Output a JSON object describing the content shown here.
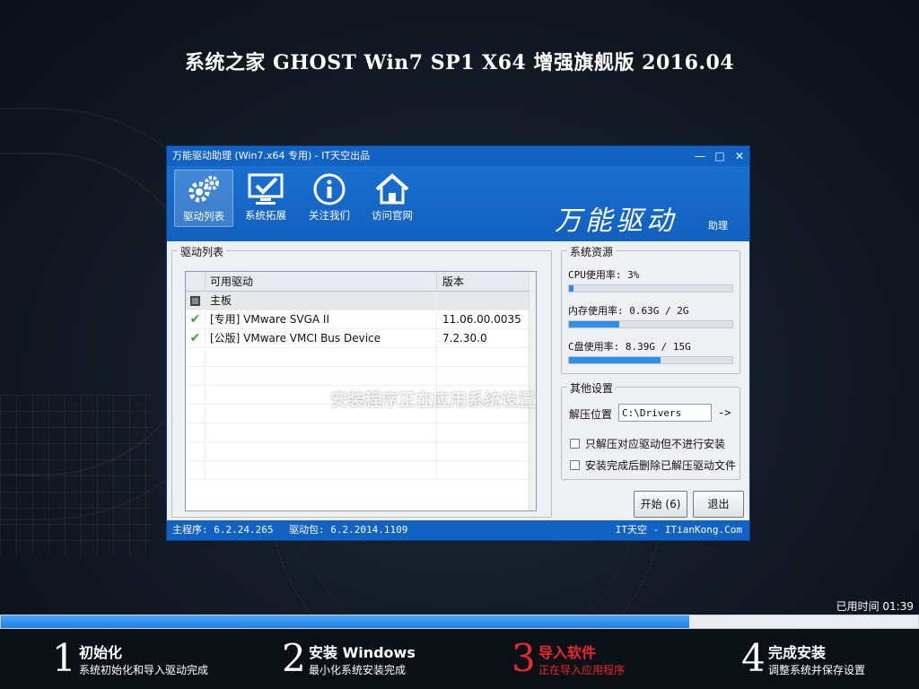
{
  "title": "系统之家 GHOST Win7 SP1 X64 增强旗舰版 2016.04",
  "window": {
    "title": "万能驱动助理 (Win7.x64 专用) - IT天空出品",
    "controls": [
      "—",
      "□",
      "✕"
    ],
    "brand": "万能驱动",
    "brand_sub": "助理",
    "toolbar": [
      {
        "label": "驱动列表",
        "icon": "gear-icon"
      },
      {
        "label": "系统拓展",
        "icon": "monitor-check-icon"
      },
      {
        "label": "关注我们",
        "icon": "info-icon"
      },
      {
        "label": "访问官网",
        "icon": "home-icon"
      }
    ],
    "driver_list": {
      "title": "驱动列表",
      "columns": [
        "可用驱动",
        "版本"
      ],
      "rows": [
        {
          "name": "主板",
          "version": "",
          "category": true
        },
        {
          "name": "[专用] VMware SVGA II",
          "version": "11.06.00.0035",
          "checked": true
        },
        {
          "name": "[公版] VMware VMCI Bus Device",
          "version": "7.2.30.0",
          "checked": true
        }
      ]
    },
    "resources": {
      "title": "系统资源",
      "cpu_label": "CPU使用率:  3%",
      "cpu_pct": 3,
      "mem_label": "内存使用率: 0.63G / 2G",
      "mem_pct": 31,
      "disk_label": "C盘使用率:  8.39G / 15G",
      "disk_pct": 56
    },
    "settings": {
      "title": "其他设置",
      "path_label": "解压位置",
      "path_value": "C:\\Drivers",
      "path_arrow": "->",
      "opt1": "只解压对应驱动但不进行安装",
      "opt2": "安装完成后删除已解压驱动文件"
    },
    "start_label": "开始 (6)",
    "exit_label": "退出",
    "overlay_status": "安装程序正在应用系统设置",
    "status_main": "主程序: 6.2.24.265",
    "status_pkg": "驱动包: 6.2.2014.1109",
    "status_site": "IT天空 - ITianKong.Com"
  },
  "elapsed": "已用时间 01:39",
  "progress_pct": 75,
  "steps": [
    {
      "num": "1",
      "title": "初始化",
      "desc": "系统初始化和导入驱动完成",
      "active": false
    },
    {
      "num": "2",
      "title": "安装 Windows",
      "desc": "最小化系统安装完成",
      "active": false
    },
    {
      "num": "3",
      "title": "导入软件",
      "desc": "正在导入应用程序",
      "active": true
    },
    {
      "num": "4",
      "title": "完成安装",
      "desc": "调整系统并保存设置",
      "active": false
    }
  ],
  "colors": {
    "active_step": "#e8292f",
    "accent": "#1262c4",
    "progress": "#2f8ee6"
  }
}
